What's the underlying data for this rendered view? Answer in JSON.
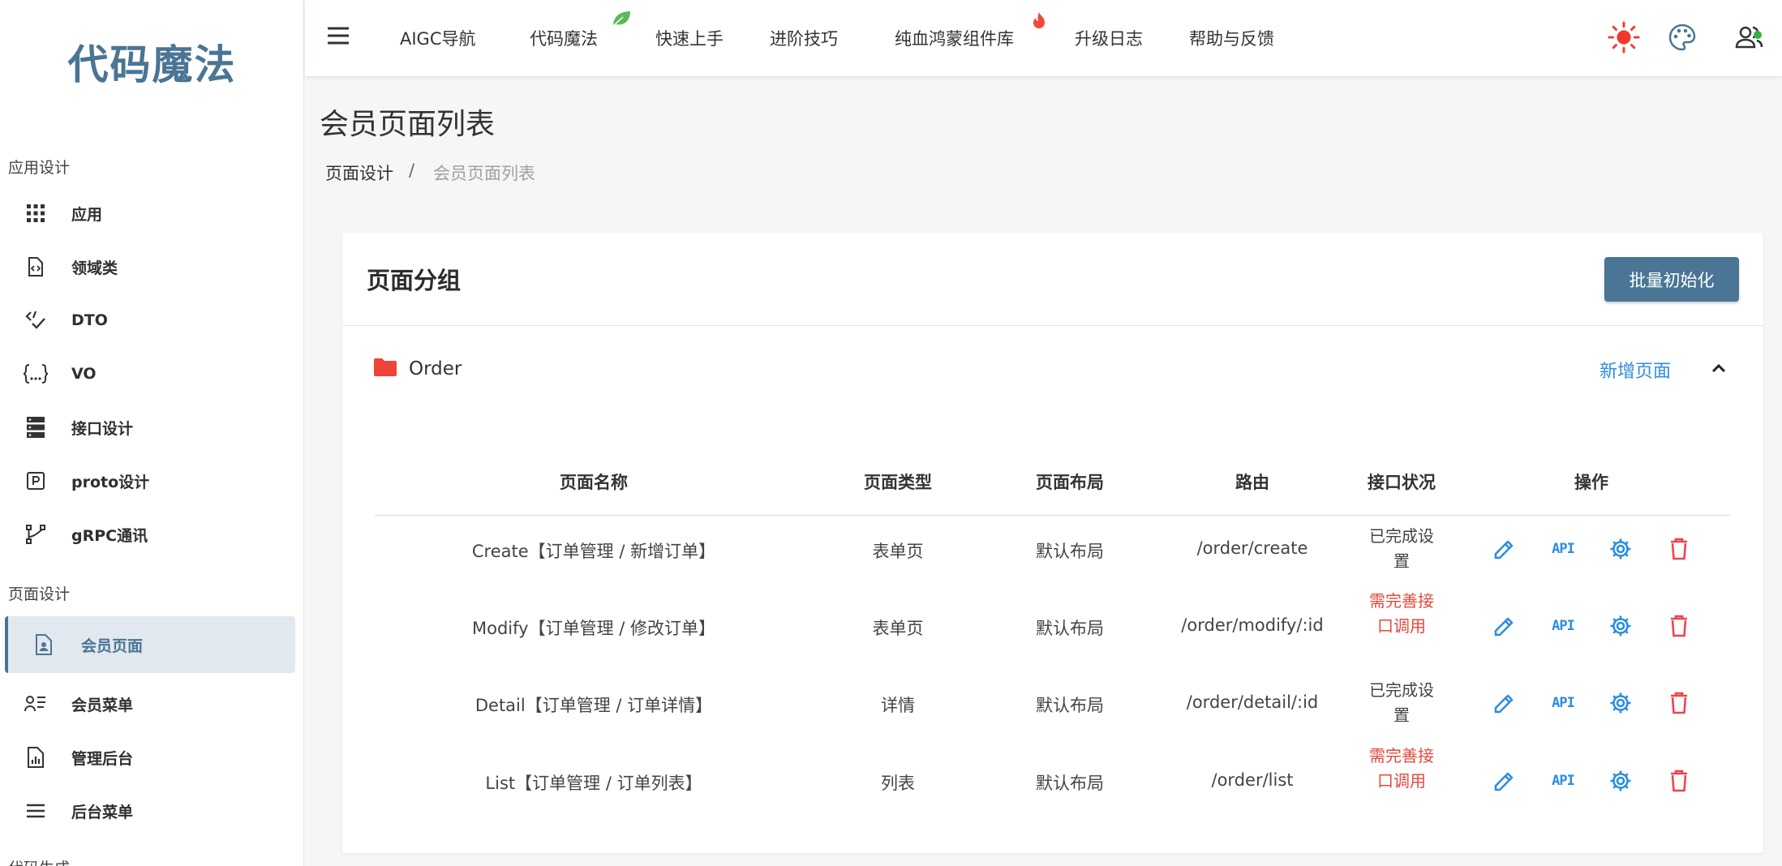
{
  "brand": {
    "logo_text": "代码魔法",
    "accent": "#4a7594"
  },
  "sidebar": {
    "sections": [
      {
        "title": "应用设计"
      },
      {
        "title": "页面设计"
      },
      {
        "title": "代码生成"
      }
    ],
    "items": [
      {
        "label": "应用",
        "icon": "grid-icon"
      },
      {
        "label": "领域类",
        "icon": "code-file-icon"
      },
      {
        "label": "DTO",
        "icon": "code-check-icon"
      },
      {
        "label": "VO",
        "icon": "braces-icon"
      },
      {
        "label": "接口设计",
        "icon": "server-icon"
      },
      {
        "label": "proto设计",
        "icon": "proto-icon"
      },
      {
        "label": "gRPC通讯",
        "icon": "branch-icon"
      },
      {
        "label": "会员页面",
        "icon": "member-file-icon",
        "active": true
      },
      {
        "label": "会员菜单",
        "icon": "member-list-icon"
      },
      {
        "label": "管理后台",
        "icon": "chart-file-icon"
      },
      {
        "label": "后台菜单",
        "icon": "menu-icon"
      }
    ]
  },
  "topnav": {
    "items": [
      {
        "label": "AIGC导航"
      },
      {
        "label": "代码魔法",
        "badge": "leaf-icon"
      },
      {
        "label": "快速上手"
      },
      {
        "label": "进阶技巧"
      },
      {
        "label": "纯血鸿蒙组件库",
        "badge": "fire-icon"
      },
      {
        "label": "升级日志"
      },
      {
        "label": "帮助与反馈"
      }
    ],
    "tools": [
      "sun-icon",
      "palette-icon",
      "user-group-icon"
    ]
  },
  "page": {
    "title": "会员页面列表",
    "breadcrumb": {
      "parent": "页面设计",
      "separator": "/",
      "current": "会员页面列表"
    }
  },
  "card": {
    "title": "页面分组",
    "batch_button": "批量初始化",
    "group": {
      "name": "Order",
      "add_page": "新增页面"
    }
  },
  "table": {
    "headers": [
      "页面名称",
      "页面类型",
      "页面布局",
      "路由",
      "接口状况",
      "操作"
    ],
    "rows": [
      {
        "name": "Create【订单管理 / 新增订单】",
        "type": "表单页",
        "layout": "默认布局",
        "route": "/order/create",
        "status": "已完成设置",
        "status_ok": true
      },
      {
        "name": "Modify【订单管理 / 修改订单】",
        "type": "表单页",
        "layout": "默认布局",
        "route": "/order/modify/:id",
        "status": "需完善接口调用",
        "status_ok": false
      },
      {
        "name": "Detail【订单管理 / 订单详情】",
        "type": "详情",
        "layout": "默认布局",
        "route": "/order/detail/:id",
        "status": "已完成设置",
        "status_ok": true
      },
      {
        "name": "List【订单管理 / 订单列表】",
        "type": "列表",
        "layout": "默认布局",
        "route": "/order/list",
        "status": "需完善接口调用",
        "status_ok": false
      }
    ],
    "action_labels": {
      "api": "API"
    }
  }
}
